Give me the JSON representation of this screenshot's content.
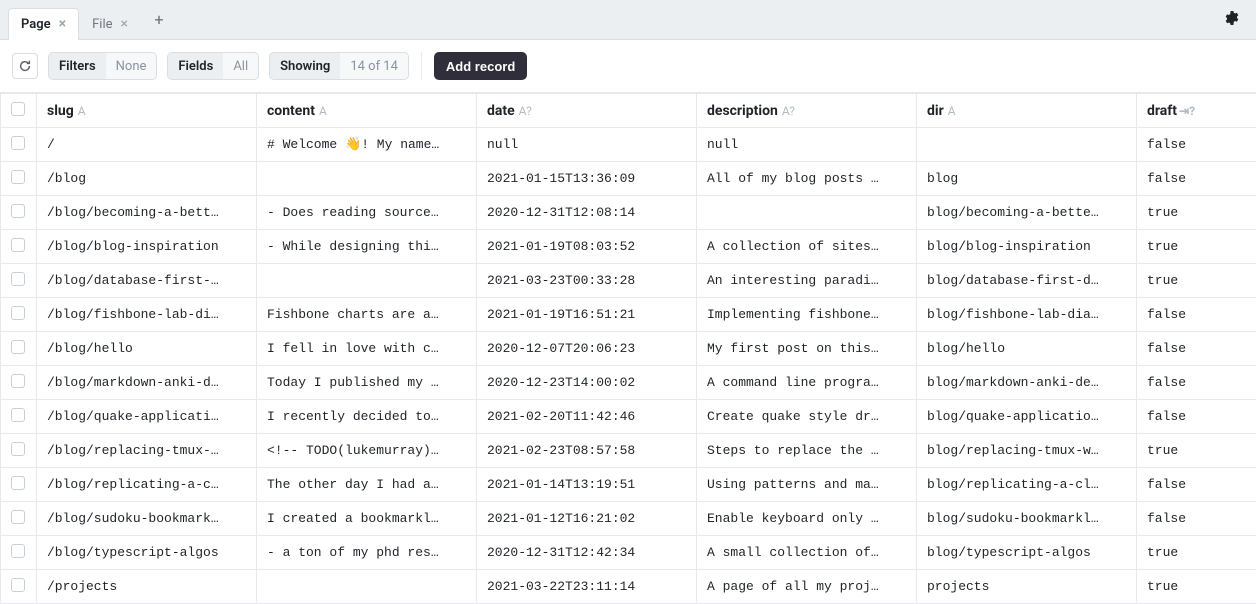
{
  "tabs": [
    {
      "label": "Page",
      "active": true
    },
    {
      "label": "File",
      "active": false
    }
  ],
  "toolbar": {
    "filters_label": "Filters",
    "filters_value": "None",
    "fields_label": "Fields",
    "fields_value": "All",
    "showing_label": "Showing",
    "showing_value": "14 of 14",
    "add_record": "Add record"
  },
  "columns": [
    {
      "key": "slug",
      "label": "slug",
      "type": "A"
    },
    {
      "key": "content",
      "label": "content",
      "type": "A"
    },
    {
      "key": "date",
      "label": "date",
      "type": "A?"
    },
    {
      "key": "description",
      "label": "description",
      "type": "A?"
    },
    {
      "key": "dir",
      "label": "dir",
      "type": "A"
    },
    {
      "key": "draft",
      "label": "draft",
      "type": "↪?"
    }
  ],
  "rows": [
    {
      "slug": "/",
      "content": "# Welcome 👋! My name…",
      "date": "null",
      "description": "null",
      "dir": "",
      "draft": "false",
      "date_null": true,
      "desc_null": true
    },
    {
      "slug": "/blog",
      "content": "",
      "date": "2021-01-15T13:36:09",
      "description": "All of my blog posts …",
      "dir": "blog",
      "draft": "false"
    },
    {
      "slug": "/blog/becoming-a-bett…",
      "content": "- Does reading source…",
      "date": "2020-12-31T12:08:14",
      "description": "",
      "dir": "blog/becoming-a-bette…",
      "draft": "true"
    },
    {
      "slug": "/blog/blog-inspiration",
      "content": "- While designing thi…",
      "date": "2021-01-19T08:03:52",
      "description": "A collection of sites…",
      "dir": "blog/blog-inspiration",
      "draft": "true"
    },
    {
      "slug": "/blog/database-first-…",
      "content": "",
      "date": "2021-03-23T00:33:28",
      "description": "An interesting paradi…",
      "dir": "blog/database-first-d…",
      "draft": "true"
    },
    {
      "slug": "/blog/fishbone-lab-di…",
      "content": "Fishbone charts are a…",
      "date": "2021-01-19T16:51:21",
      "description": "Implementing fishbone…",
      "dir": "blog/fishbone-lab-dia…",
      "draft": "false"
    },
    {
      "slug": "/blog/hello",
      "content": "I fell in love with c…",
      "date": "2020-12-07T20:06:23",
      "description": "My first post on this…",
      "dir": "blog/hello",
      "draft": "false"
    },
    {
      "slug": "/blog/markdown-anki-d…",
      "content": "Today I published my …",
      "date": "2020-12-23T14:00:02",
      "description": "A command line progra…",
      "dir": "blog/markdown-anki-de…",
      "draft": "false"
    },
    {
      "slug": "/blog/quake-applicati…",
      "content": "I recently decided to…",
      "date": "2021-02-20T11:42:46",
      "description": "Create quake style dr…",
      "dir": "blog/quake-applicatio…",
      "draft": "false"
    },
    {
      "slug": "/blog/replacing-tmux-…",
      "content": "<!-- TODO(lukemurray)…",
      "date": "2021-02-23T08:57:58",
      "description": "Steps to replace the …",
      "dir": "blog/replacing-tmux-w…",
      "draft": "true"
    },
    {
      "slug": "/blog/replicating-a-c…",
      "content": "The other day I had a…",
      "date": "2021-01-14T13:19:51",
      "description": "Using patterns and ma…",
      "dir": "blog/replicating-a-cl…",
      "draft": "false"
    },
    {
      "slug": "/blog/sudoku-bookmark…",
      "content": "I created a bookmarkl…",
      "date": "2021-01-12T16:21:02",
      "description": "Enable keyboard only …",
      "dir": "blog/sudoku-bookmarkl…",
      "draft": "false"
    },
    {
      "slug": "/blog/typescript-algos",
      "content": "- a ton of my phd res…",
      "date": "2020-12-31T12:42:34",
      "description": "A small collection of…",
      "dir": "blog/typescript-algos",
      "draft": "true"
    },
    {
      "slug": "/projects",
      "content": "",
      "date": "2021-03-22T23:11:14",
      "description": "A page of all my proj…",
      "dir": "projects",
      "draft": "true"
    }
  ]
}
